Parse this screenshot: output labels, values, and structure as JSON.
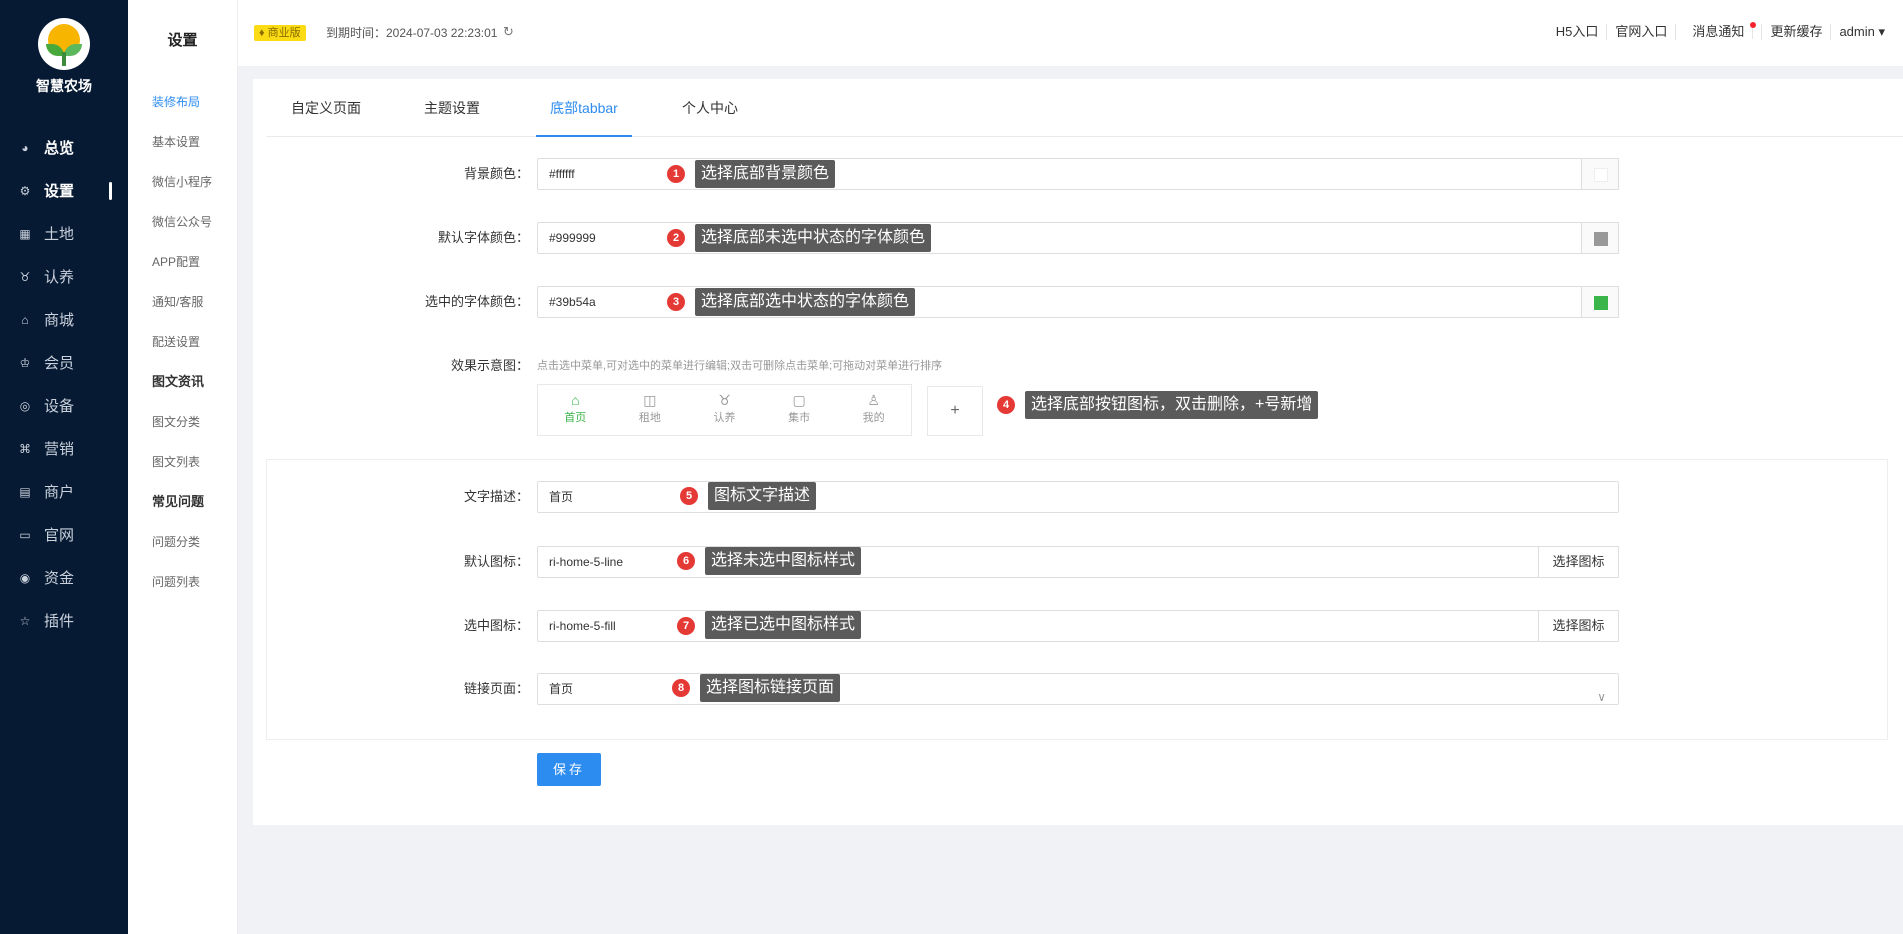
{
  "brand": {
    "name": "智慧农场"
  },
  "nav": [
    {
      "label": "总览",
      "icon": "dashboard-icon"
    },
    {
      "label": "设置",
      "icon": "gear-icon"
    },
    {
      "label": "土地",
      "icon": "grid-icon"
    },
    {
      "label": "认养",
      "icon": "adopt-icon"
    },
    {
      "label": "商城",
      "icon": "shop-icon"
    },
    {
      "label": "会员",
      "icon": "member-icon"
    },
    {
      "label": "设备",
      "icon": "device-icon"
    },
    {
      "label": "营销",
      "icon": "marketing-icon"
    },
    {
      "label": "商户",
      "icon": "merchant-icon"
    },
    {
      "label": "官网",
      "icon": "website-icon"
    },
    {
      "label": "资金",
      "icon": "money-icon"
    },
    {
      "label": "插件",
      "icon": "star-icon"
    }
  ],
  "subside": {
    "title": "设置",
    "items": [
      "装修布局",
      "基本设置",
      "微信小程序",
      "微信公众号",
      "APP配置",
      "通知/客服",
      "配送设置"
    ],
    "group1": "图文资讯",
    "group1_items": [
      "图文分类",
      "图文列表"
    ],
    "group2": "常见问题",
    "group2_items": [
      "问题分类",
      "问题列表"
    ]
  },
  "header": {
    "badge": "商业版",
    "expire": "到期时间：2024-07-03 22:23:01",
    "links": [
      "H5入口",
      "官网入口",
      "消息通知",
      "更新缓存",
      "admin ▾"
    ]
  },
  "tabs": [
    "自定义页面",
    "主题设置",
    "底部tabbar",
    "个人中心"
  ],
  "form": {
    "bg_label": "背景颜色：",
    "bg_value": "#ffffff",
    "bg_tip": "选择底部背景颜色",
    "font_label": "默认字体颜色：",
    "font_value": "#999999",
    "font_tip": "选择底部未选中状态的字体颜色",
    "sel_label": "选中的字体颜色：",
    "sel_value": "#39b54a",
    "sel_tip": "选择底部选中状态的字体颜色",
    "preview_label": "效果示意图：",
    "preview_hint": "点击选中菜单,可对选中的菜单进行编辑;双击可删除点击菜单;可拖动对菜单进行排序",
    "preview_tip": "选择底部按钮图标，双击删除，+号新增",
    "plus": "+",
    "tabbar": [
      "首页",
      "租地",
      "认养",
      "集市",
      "我的"
    ],
    "desc_label": "文字描述：",
    "desc_value": "首页",
    "desc_tip": "图标文字描述",
    "icon_label": "默认图标：",
    "icon_value": "ri-home-5-line",
    "icon_tip": "选择未选中图标样式",
    "icon_btn": "选择图标",
    "sicon_label": "选中图标：",
    "sicon_value": "ri-home-5-fill",
    "sicon_tip": "选择已选中图标样式",
    "sicon_btn": "选择图标",
    "link_label": "链接页面：",
    "link_value": "首页",
    "link_tip": "选择图标链接页面",
    "save": "保存"
  },
  "nums": [
    "1",
    "2",
    "3",
    "4",
    "5",
    "6",
    "7",
    "8"
  ],
  "colors": {
    "accent": "#2d8cf0",
    "sidebar": "#071a33",
    "selected": "#39b54a",
    "default_font": "#999999"
  }
}
